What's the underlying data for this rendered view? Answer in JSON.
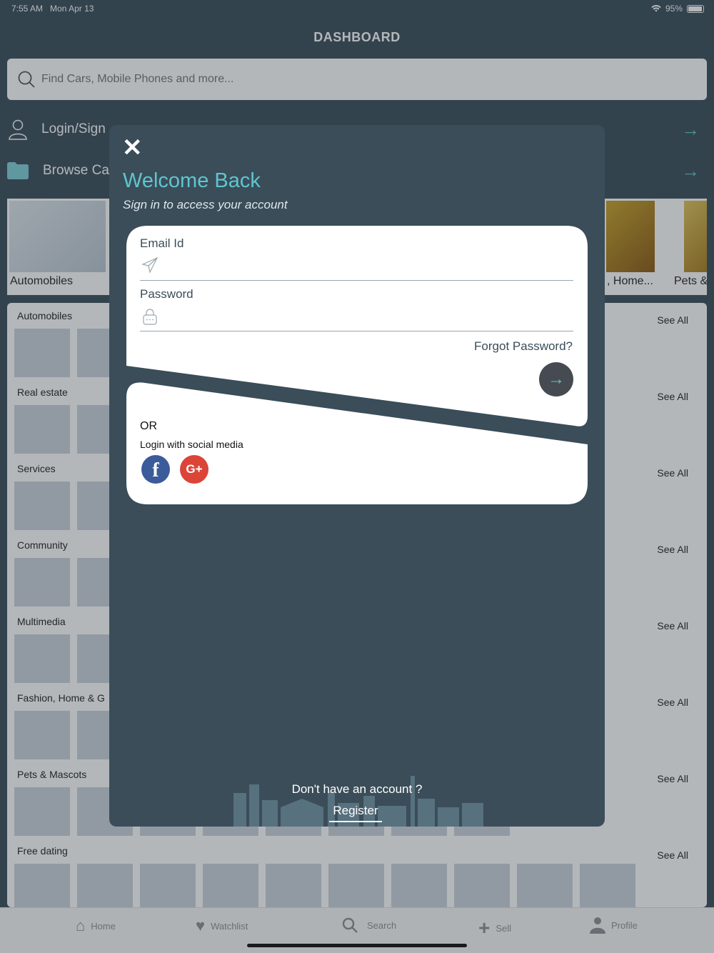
{
  "status": {
    "time": "7:55 AM",
    "date": "Mon Apr 13",
    "battery": "95%"
  },
  "dashboard": {
    "title": "DASHBOARD",
    "search_placeholder": "Find Cars, Mobile Phones and more...",
    "menu": [
      {
        "label": "Login/Sign"
      },
      {
        "label": "Browse Ca"
      }
    ],
    "categories": [
      {
        "label": "Automobiles"
      },
      {
        "label": ", Home..."
      },
      {
        "label": "Pets &"
      }
    ],
    "sections": [
      {
        "title": "Automobiles",
        "see_all": "See All"
      },
      {
        "title": "Real estate",
        "see_all": "See All"
      },
      {
        "title": "Services",
        "see_all": "See All"
      },
      {
        "title": "Community",
        "see_all": "See All"
      },
      {
        "title": "Multimedia",
        "see_all": "See All"
      },
      {
        "title": "Fashion, Home & G",
        "see_all": "See All"
      },
      {
        "title": "Pets & Mascots",
        "see_all": "See All"
      },
      {
        "title": "Free dating",
        "see_all": "See All"
      }
    ]
  },
  "tabs": [
    {
      "label": "Home",
      "icon": "home-icon"
    },
    {
      "label": "Watchlist",
      "icon": "heart-icon"
    },
    {
      "label": "Search",
      "icon": "search-icon"
    },
    {
      "label": "Sell",
      "icon": "plus-icon"
    },
    {
      "label": "Profile",
      "icon": "user-icon"
    }
  ],
  "login_modal": {
    "title": "Welcome Back",
    "subtitle": "Sign in to access your account",
    "email_label": "Email Id",
    "email_value": "",
    "password_label": "Password",
    "password_value": "",
    "forgot_password": "Forgot Password?",
    "or_text": "OR",
    "social_text": "Login with social media",
    "facebook_glyph": "f",
    "google_glyph": "G+",
    "no_account_text": "Don't have an account ?",
    "register_label": "Register"
  },
  "colors": {
    "background": "#3a4d59",
    "accent": "#5ec6cf",
    "facebook": "#3b5b9a",
    "google": "#db4437",
    "submit_button": "#454b50"
  }
}
